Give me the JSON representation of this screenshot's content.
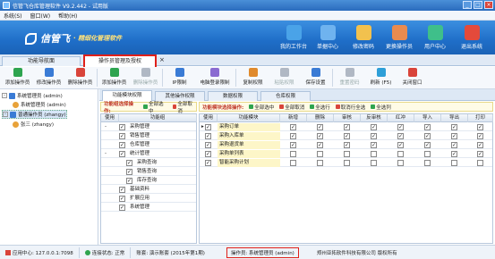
{
  "titlebar": {
    "title": "信管飞仓库管理软件 V9.2.442 - 试用版"
  },
  "menu": [
    "系统(S)",
    "窗口(W)",
    "帮助(H)"
  ],
  "banner": {
    "logo": "信管飞",
    "slogan": "· 精细化管理软件"
  },
  "nav": [
    {
      "label": "我的工作台",
      "color": "#4aa3e8"
    },
    {
      "label": "单据中心",
      "color": "#6fb3ef"
    },
    {
      "label": "修改密码",
      "color": "#f2c14e"
    },
    {
      "label": "更换操作员",
      "color": "#e98b4f"
    },
    {
      "label": "用户中心",
      "color": "#3fbf8a"
    },
    {
      "label": "退出系统",
      "color": "#e44a3b"
    }
  ],
  "tabs": {
    "home": "功能导航面",
    "active": "操作员管理及授权"
  },
  "toolbar": [
    {
      "label": "添加操作员",
      "color": "#2ea44f",
      "dis": false
    },
    {
      "label": "修改操作员",
      "color": "#3a7bd5",
      "dis": false
    },
    {
      "label": "删除操作员",
      "color": "#d9443a",
      "dis": false
    },
    {
      "label": "添加操作员",
      "color": "#2ea44f",
      "dis": false
    },
    {
      "label": "删除操作员",
      "color": "#b0b8c4",
      "dis": true
    },
    {
      "label": "IP限制",
      "color": "#3a7bd5",
      "dis": false
    },
    {
      "label": "电脑登录限制",
      "color": "#8a6bd1",
      "dis": false
    },
    {
      "label": "复制权限",
      "color": "#e08a2c",
      "dis": false
    },
    {
      "label": "粘贴权限",
      "color": "#b0b8c4",
      "dis": true
    },
    {
      "label": "保存设置",
      "color": "#3a7bd5",
      "dis": false
    },
    {
      "label": "重置密码",
      "color": "#b0b8c4",
      "dis": true
    },
    {
      "label": "刷新 (F5)",
      "color": "#2e9fd8",
      "dis": false
    },
    {
      "label": "关闭窗口",
      "color": "#d9443a",
      "dis": false
    }
  ],
  "tree": {
    "root1": "系统管理员 (admin)",
    "child1": "系统管理员 (admin)",
    "root2": "普通操作员 (zhangy)",
    "child2": "张三 (zhangy)"
  },
  "rtabs": [
    "功能模块权限",
    "其他操作权限",
    "数据权限",
    "仓库权限"
  ],
  "opbar_left": {
    "label": "功能组选择操作:",
    "items": [
      "全部选中",
      "全部取消"
    ]
  },
  "opbar_right": {
    "label": "功能模块选择操作:",
    "items": [
      "全部选中",
      "全部取消",
      "全选行",
      "取消行全选",
      "全选列"
    ]
  },
  "lgrid": {
    "headers": [
      "使用",
      "功能组"
    ],
    "rows": [
      {
        "name": "采购管理",
        "checked": true,
        "indent": 0,
        "expand": "-"
      },
      {
        "name": "销售管理",
        "checked": true,
        "indent": 0,
        "expand": ""
      },
      {
        "name": "仓库管理",
        "checked": true,
        "indent": 0,
        "expand": ""
      },
      {
        "name": "统计管理",
        "checked": true,
        "indent": 0,
        "expand": "-"
      },
      {
        "name": "采购查询",
        "checked": true,
        "indent": 1,
        "expand": ""
      },
      {
        "name": "销售查询",
        "checked": true,
        "indent": 1,
        "expand": ""
      },
      {
        "name": "库存查询",
        "checked": true,
        "indent": 1,
        "expand": ""
      },
      {
        "name": "基础资料",
        "checked": true,
        "indent": 0,
        "expand": ""
      },
      {
        "name": "扩展应用",
        "checked": true,
        "indent": 0,
        "expand": ""
      },
      {
        "name": "系统管理",
        "checked": true,
        "indent": 0,
        "expand": ""
      }
    ]
  },
  "rgrid": {
    "headers": [
      "使用",
      "功能模块",
      "新增",
      "删除",
      "审核",
      "反审核",
      "红冲",
      "导入",
      "导出",
      "打印"
    ],
    "rows": [
      {
        "name": "采购订单",
        "cells": [
          true,
          true,
          true,
          true,
          true,
          true,
          true,
          true,
          true
        ]
      },
      {
        "name": "采购入库单",
        "cells": [
          true,
          true,
          true,
          true,
          true,
          true,
          true,
          true,
          true
        ]
      },
      {
        "name": "采购退货单",
        "cells": [
          true,
          true,
          true,
          true,
          true,
          true,
          true,
          true,
          true
        ]
      },
      {
        "name": "采购单列表",
        "cells": [
          true,
          false,
          false,
          false,
          false,
          false,
          false,
          true,
          true
        ]
      },
      {
        "name": "智能采购计划",
        "cells": [
          true,
          false,
          false,
          false,
          false,
          false,
          false,
          false,
          false
        ]
      }
    ]
  },
  "status": {
    "center": "应用中心: 127.0.0.1:7098",
    "conn": "连接状态: 正常",
    "account": "账套: 演示账套 (2015年第1期)",
    "operator": "操作员: 系统管理员 (admin)",
    "company": "郑州亚拓软件科技有限公司  版权所有"
  }
}
